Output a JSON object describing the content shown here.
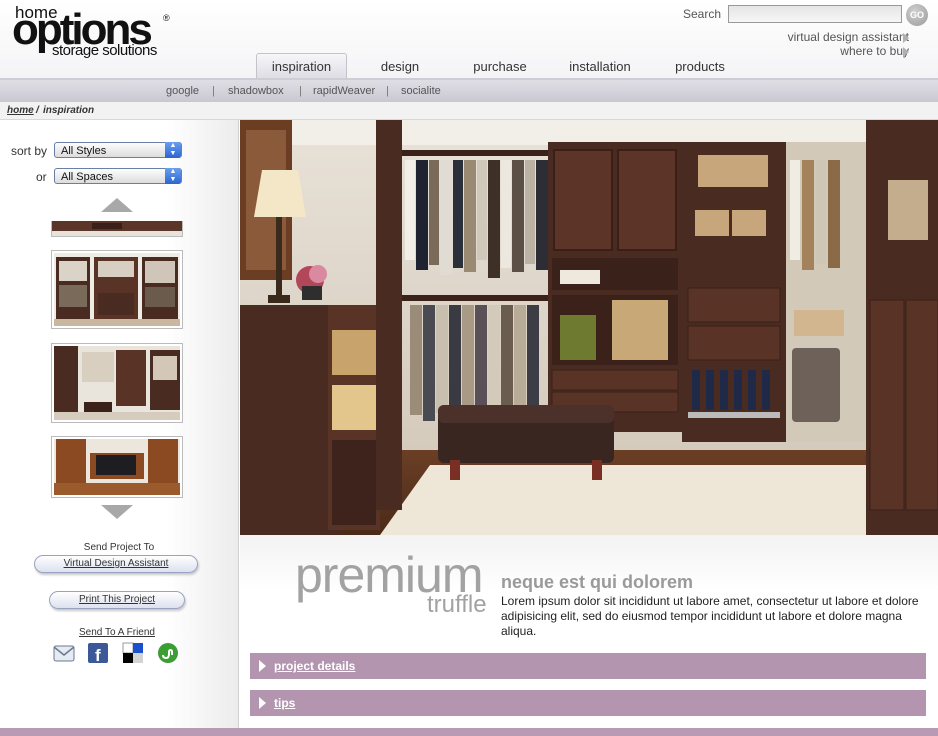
{
  "header": {
    "logo": {
      "line1": "home",
      "line2": "options",
      "line3": "storage solutions",
      "registered": "®"
    },
    "search": {
      "label": "Search",
      "value": "",
      "placeholder": "",
      "button": "GO"
    },
    "links": [
      {
        "label": "virtual design assistant"
      },
      {
        "label": "where to buy"
      }
    ]
  },
  "nav": {
    "tabs": [
      {
        "label": "inspiration",
        "active": true
      },
      {
        "label": "design"
      },
      {
        "label": "purchase"
      },
      {
        "label": "installation"
      },
      {
        "label": "products"
      }
    ],
    "subnav": [
      {
        "label": "google"
      },
      {
        "label": "shadowbox"
      },
      {
        "label": "rapidWeaver"
      },
      {
        "label": "socialite"
      }
    ],
    "separator": "|"
  },
  "breadcrumb": {
    "home": "home",
    "separator": "/",
    "current": "inspiration"
  },
  "sidebar": {
    "sort_label": "sort by",
    "sort_value": "All Styles",
    "or_label": "or",
    "spaces_value": "All Spaces",
    "send_project_label": "Send Project To",
    "vda_button": "Virtual Design Assistant",
    "print_button": "Print This Project",
    "send_friend": "Send To A Friend"
  },
  "main": {
    "collection_name": "premium",
    "collection_finish": "truffle",
    "headline": "neque est qui dolorem",
    "body": "Lorem ipsum dolor sit incididunt ut labore amet, consectetur ut labore et dolore adipisicing elit, sed do eiusmod tempor incididunt ut labore et dolore magna aliqua.",
    "accordions": [
      {
        "label": "project details"
      },
      {
        "label": "tips"
      }
    ]
  },
  "colors": {
    "accent": "#b395b0",
    "tab_bar": "#c9c7d0",
    "wood": "#4a2b22",
    "text_gray": "#a2a2a2"
  }
}
